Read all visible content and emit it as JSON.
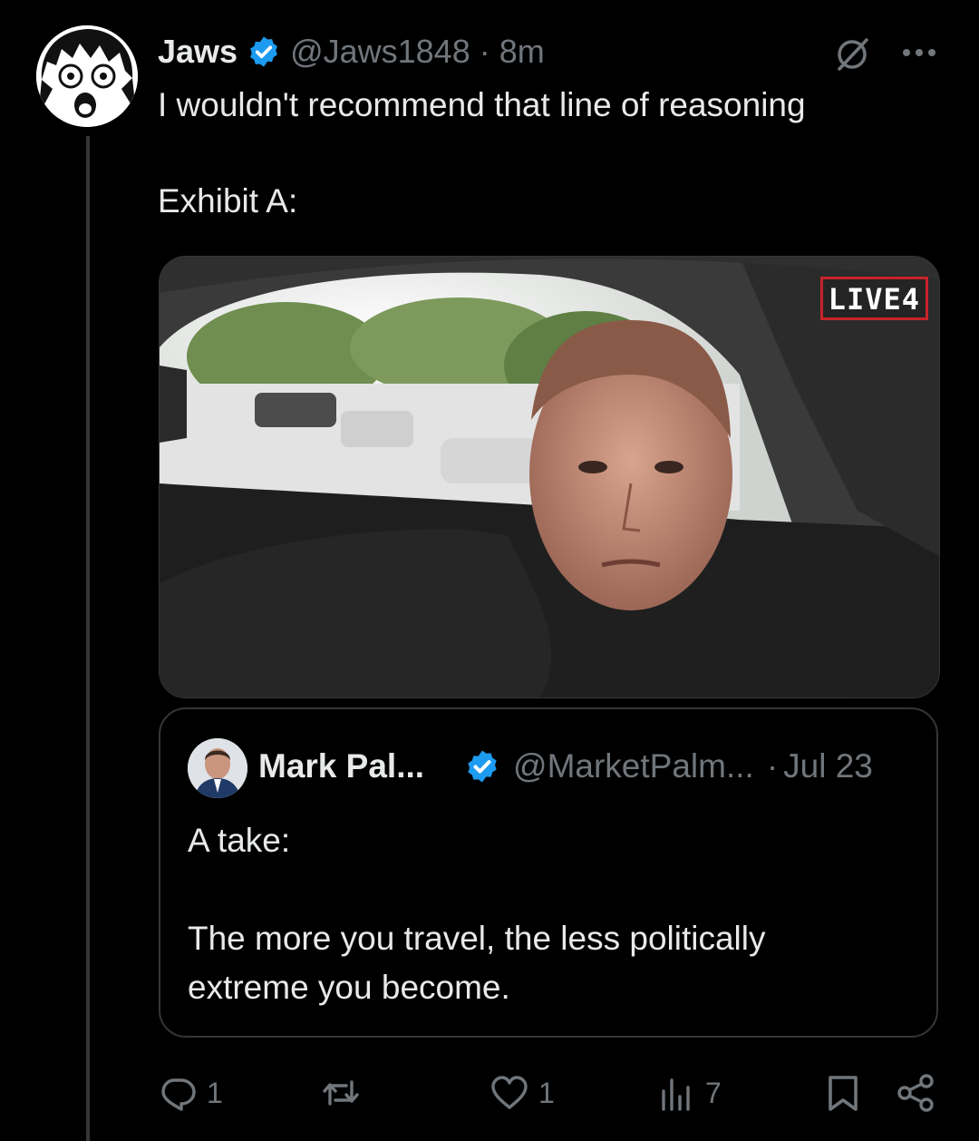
{
  "author": {
    "name": "Jaws",
    "handle": "@Jaws1848",
    "separator": "·",
    "time": "8m",
    "verified": true,
    "avatar_icon": "anime-avatar-icon"
  },
  "tweet": {
    "line1": "I wouldn't recommend that line of reasoning",
    "line2": "Exhibit A:"
  },
  "media": {
    "badge": "LIVE4"
  },
  "quote": {
    "name": "Mark Pal...",
    "handle": "@MarketPalm...",
    "separator": "·",
    "time": "Jul 23",
    "verified": true,
    "line1": "A take:",
    "line2": "The more you travel, the less politically",
    "line3": "extreme you become."
  },
  "actions": {
    "replies": "1",
    "reposts": "",
    "likes": "1",
    "views": "7"
  },
  "colors": {
    "background": "#000000",
    "text": "#e7e9ea",
    "muted": "#71767b",
    "border": "#333639",
    "verified": "#1d9bf0"
  }
}
